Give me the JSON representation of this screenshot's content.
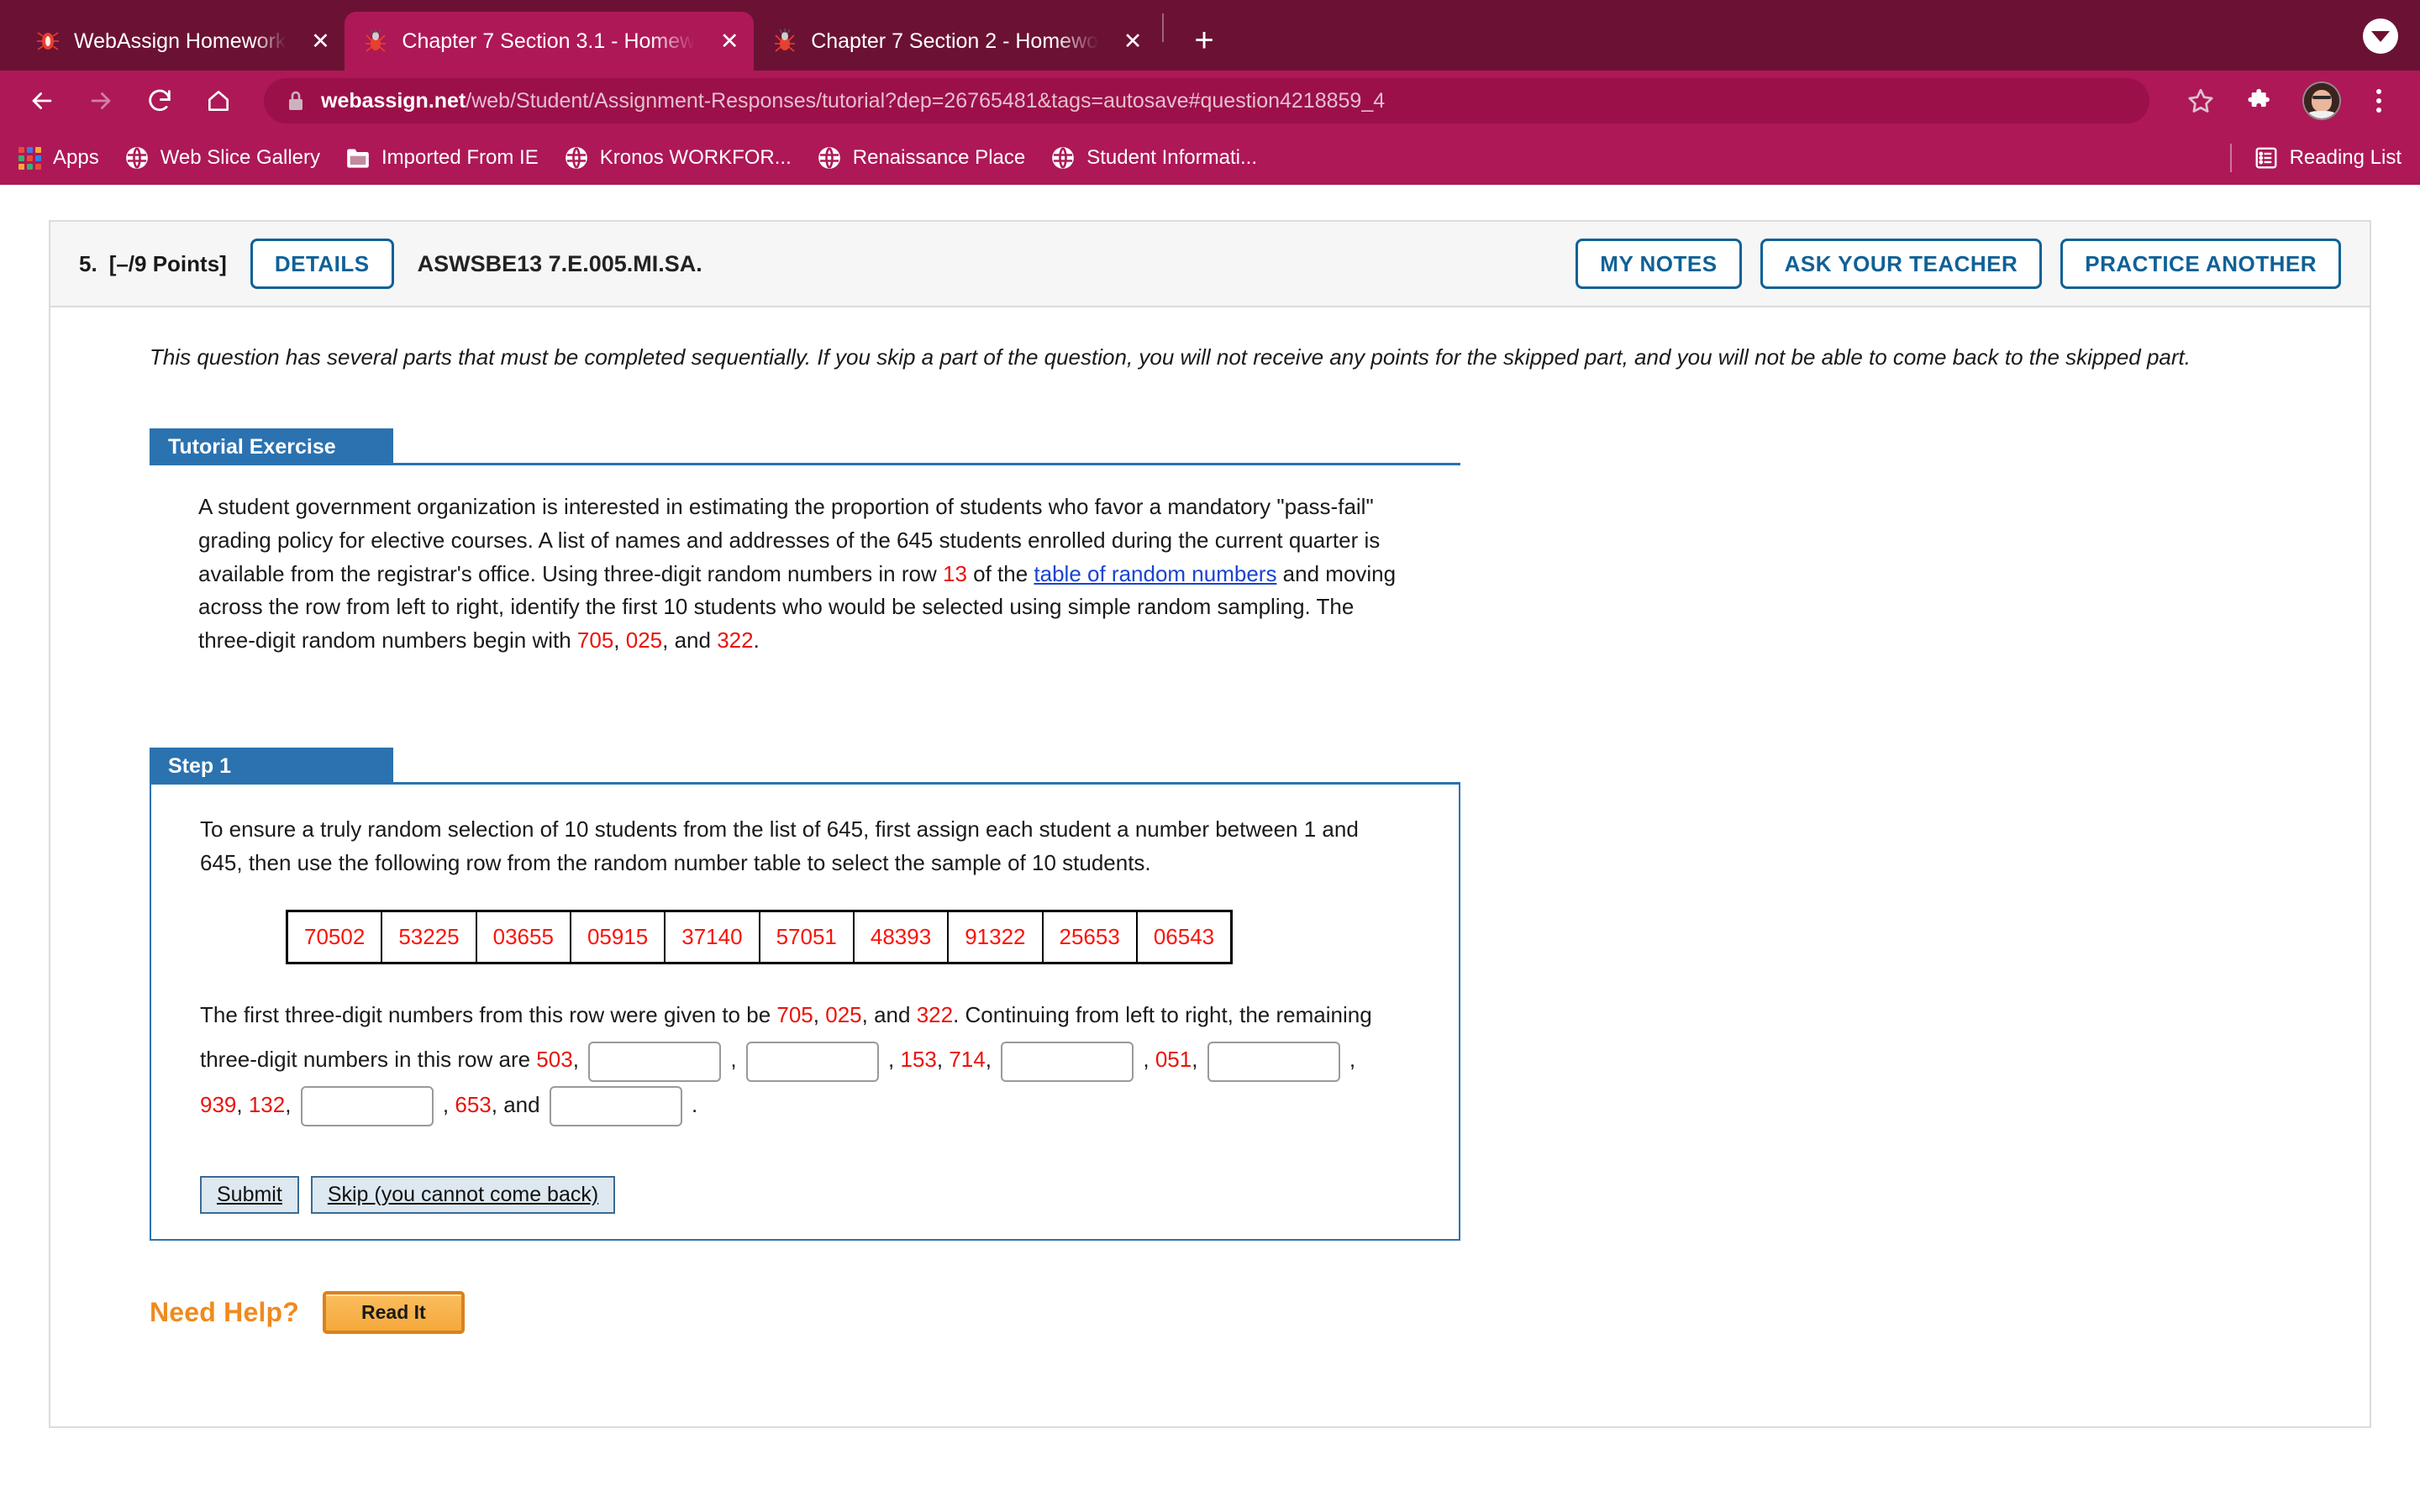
{
  "browser": {
    "tabs": [
      {
        "title": "WebAssign Homework",
        "active": false,
        "favicon": "webassign-spider-icon"
      },
      {
        "title": "Chapter 7 Section 3.1 - Homew",
        "active": true,
        "favicon": "webassign-spider-icon"
      },
      {
        "title": "Chapter 7 Section 2 - Homewo",
        "active": false,
        "favicon": "webassign-spider-icon"
      }
    ],
    "tab_close_label": "✕",
    "new_tab_label": "+",
    "url_domain": "webassign.net",
    "url_path": "/web/Student/Assignment-Responses/tutorial?dep=26765481&tags=autosave#question4218859_4",
    "bookmarks": [
      {
        "label": "Apps",
        "icon": "apps-grid-icon"
      },
      {
        "label": "Web Slice Gallery",
        "icon": "globe-icon"
      },
      {
        "label": "Imported From IE",
        "icon": "folder-icon"
      },
      {
        "label": "Kronos WORKFOR...",
        "icon": "globe-icon"
      },
      {
        "label": "Renaissance Place",
        "icon": "globe-icon"
      },
      {
        "label": "Student Informati...",
        "icon": "globe-icon"
      }
    ],
    "reading_list_label": "Reading List",
    "colors": {
      "tabstrip": "#6b1234",
      "toolbar": "#ae1857",
      "omnibox": "#9c1049"
    }
  },
  "question": {
    "number": "5.",
    "points": "[–/9 Points]",
    "details_label": "DETAILS",
    "code": "ASWSBE13 7.E.005.MI.SA.",
    "actions": [
      {
        "label": "MY NOTES"
      },
      {
        "label": "ASK YOUR TEACHER"
      },
      {
        "label": "PRACTICE ANOTHER"
      }
    ],
    "intro": "This question has several parts that must be completed sequentially. If you skip a part of the question, you will not receive any points for the skipped part, and you will not be able to come back to the skipped part."
  },
  "tutorial": {
    "heading": "Tutorial Exercise",
    "body_part1": "A student government organization is interested in estimating the proportion of students who favor a mandatory \"pass-fail\" grading policy for elective courses. A list of names and addresses of the 645 students enrolled during the current quarter is available from the registrar's office. Using three-digit random numbers in row ",
    "row_number": "13",
    "body_part2": " of the ",
    "link_text": "table of random numbers",
    "body_part3": " and moving across the row from left to right, identify the first 10 students who would be selected using simple random sampling. The three-digit random numbers begin with ",
    "seed1": "705",
    "seed_sep1": ", ",
    "seed2": "025",
    "seed_sep2": ", and ",
    "seed3": "322",
    "body_end": "."
  },
  "step1": {
    "heading": "Step 1",
    "body": "To ensure a truly random selection of 10 students from the list of 645, first assign each student a number between 1 and 645, then use the following row from the random number table to select the sample of 10 students.",
    "random_row": [
      "70502",
      "53225",
      "03655",
      "05915",
      "37140",
      "57051",
      "48393",
      "91322",
      "25653",
      "06543"
    ],
    "fill_part1": "The first three-digit numbers from this row were given to be ",
    "given1": "705",
    "given2": "025",
    "given3": "322",
    "fill_part2": ". Continuing from left to right, the remaining three-digit numbers in this row are ",
    "known": {
      "v503": "503",
      "v153": "153",
      "v714": "714",
      "v051": "051",
      "v939": "939",
      "v132": "132",
      "v653": "653"
    },
    "connector_and": ", and ",
    "period": ".",
    "inputs": [
      {
        "name": "blank-1",
        "value": "",
        "placeholder": ""
      },
      {
        "name": "blank-2",
        "value": "",
        "placeholder": ""
      },
      {
        "name": "blank-3",
        "value": "",
        "placeholder": ""
      },
      {
        "name": "blank-4",
        "value": "",
        "placeholder": ""
      },
      {
        "name": "blank-5",
        "value": "",
        "placeholder": ""
      },
      {
        "name": "blank-6",
        "value": "",
        "placeholder": ""
      }
    ],
    "submit_label": "Submit",
    "skip_label": "Skip (you cannot come back)"
  },
  "help": {
    "label": "Need Help?",
    "read_it_label": "Read It"
  }
}
